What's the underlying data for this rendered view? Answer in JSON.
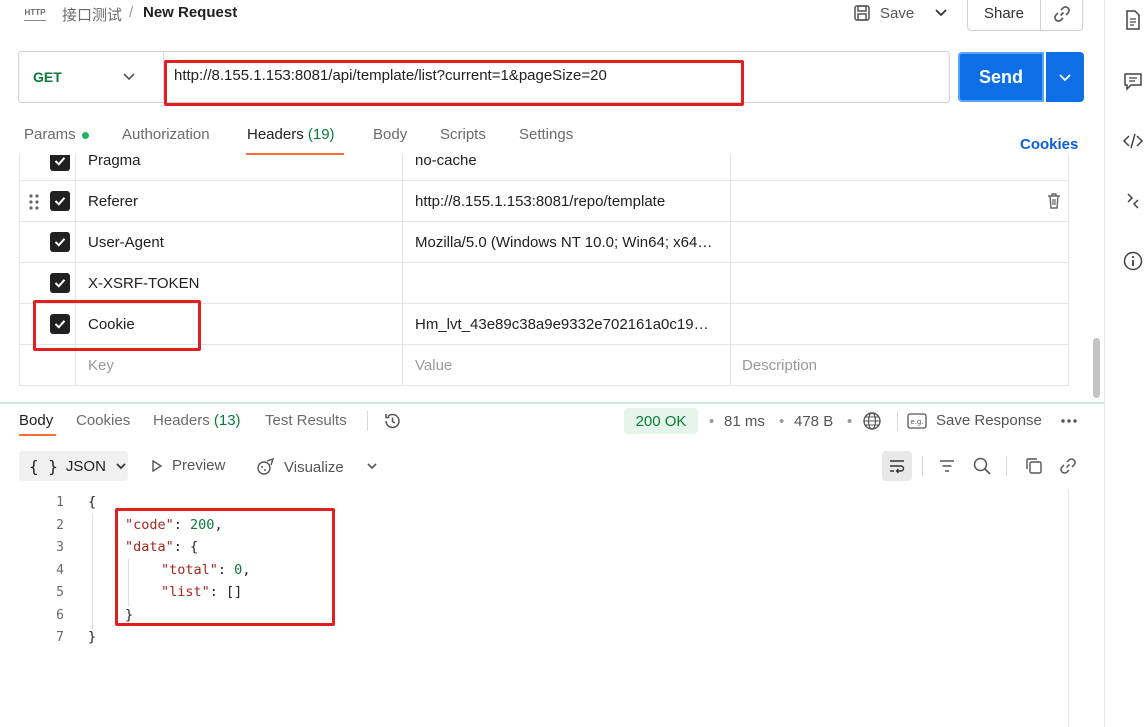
{
  "header": {
    "badge": "HTTP",
    "breadcrumb_parent": "接口测试",
    "breadcrumb_sep": "/",
    "title": "New Request",
    "save_label": "Save",
    "share_label": "Share"
  },
  "request": {
    "method": "GET",
    "url": "http://8.155.1.153:8081/api/template/list?current=1&pageSize=20",
    "send_label": "Send"
  },
  "request_tabs": {
    "params": "Params",
    "authorization": "Authorization",
    "headers": "Headers",
    "headers_count": "(19)",
    "body": "Body",
    "scripts": "Scripts",
    "settings": "Settings",
    "cookies_link": "Cookies",
    "active": "Headers"
  },
  "headers_table": {
    "rows": [
      {
        "key": "Pragma",
        "value": "no-cache",
        "description": "",
        "checked": true
      },
      {
        "key": "Referer",
        "value": "http://8.155.1.153:8081/repo/template",
        "description": "",
        "checked": true
      },
      {
        "key": "User-Agent",
        "value": "Mozilla/5.0 (Windows NT 10.0; Win64; x64…",
        "description": "",
        "checked": true
      },
      {
        "key": "X-XSRF-TOKEN",
        "value": "",
        "description": "",
        "checked": true
      },
      {
        "key": "Cookie",
        "value": "Hm_lvt_43e89c38a9e9332e702161a0c19…",
        "description": "",
        "checked": true
      }
    ],
    "placeholder": {
      "key": "Key",
      "value": "Value",
      "description": "Description"
    }
  },
  "response_tabs": {
    "body": "Body",
    "cookies": "Cookies",
    "headers": "Headers",
    "headers_count": "(13)",
    "test_results": "Test Results",
    "active": "Body"
  },
  "response_meta": {
    "status": "200 OK",
    "time": "81 ms",
    "size": "478 B",
    "save_response": "Save Response",
    "sep": "•"
  },
  "response_toolbar": {
    "format": "JSON",
    "preview": "Preview",
    "visualize": "Visualize"
  },
  "response_body": {
    "line_numbers": [
      "1",
      "2",
      "3",
      "4",
      "5",
      "6",
      "7"
    ]
  },
  "colors": {
    "accent_orange": "#ff6c37",
    "send_blue": "#0d6fe6",
    "status_green": "#0c7a3b",
    "annotation_red": "#e02020"
  }
}
